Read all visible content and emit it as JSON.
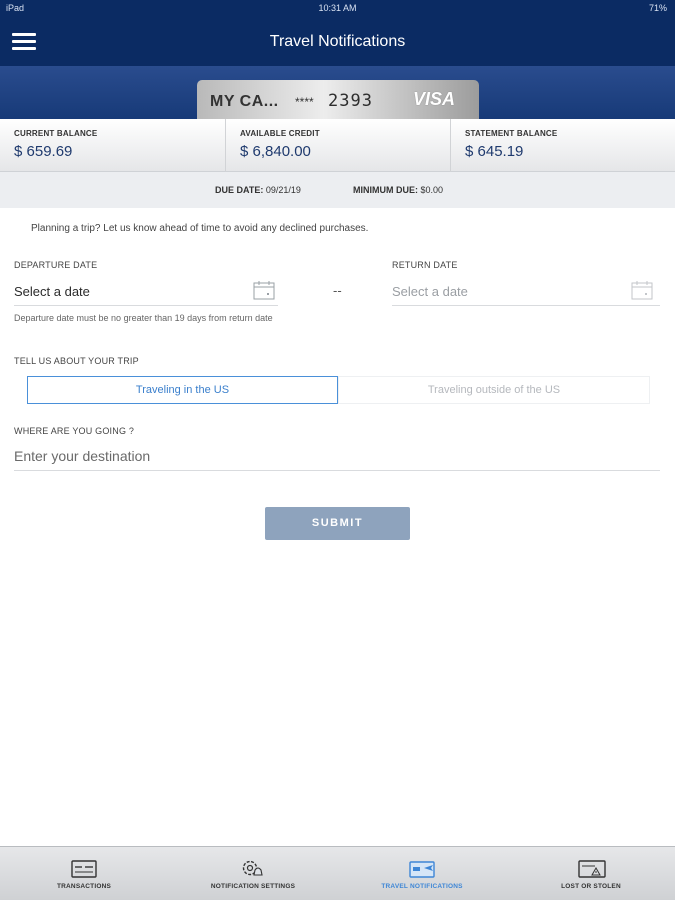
{
  "status_bar": {
    "left": "iPad",
    "time": "10:31 AM",
    "right": "71%"
  },
  "header": {
    "title": "Travel Notifications",
    "menu_icon": "hamburger-icon"
  },
  "card": {
    "name": "MY CA...",
    "mask": "****",
    "last_digits": "2393",
    "brand": "VISA"
  },
  "balances": [
    {
      "label": "CURRENT BALANCE",
      "value": "$ 659.69"
    },
    {
      "label": "AVAILABLE CREDIT",
      "value": "$ 6,840.00"
    },
    {
      "label": "STATEMENT BALANCE",
      "value": "$ 645.19"
    }
  ],
  "due": {
    "due_label": "DUE DATE:",
    "due_value": "09/21/19",
    "min_label": "MINIMUM DUE:",
    "min_value": "$0.00"
  },
  "form": {
    "intro": "Planning a trip? Let us know ahead of time to avoid any declined purchases.",
    "departure_label": "DEPARTURE DATE",
    "departure_value": "Select a date",
    "return_label": "RETURN DATE",
    "return_value": "Select a date",
    "separator": "--",
    "hint": "Departure date must be no greater than 19 days from return date",
    "trip_label": "TELL US ABOUT YOUR TRIP",
    "trip_options": [
      "Traveling in the US",
      "Traveling outside of the US"
    ],
    "trip_selected": "Traveling in the US",
    "destination_label": "WHERE ARE YOU GOING ?",
    "destination_placeholder": "Enter your destination",
    "destination_value": "",
    "submit_label": "SUBMIT"
  },
  "tabs": [
    {
      "label": "TRANSACTIONS",
      "icon": "card-list-icon",
      "active": false
    },
    {
      "label": "NOTIFICATION SETTINGS",
      "icon": "gear-bell-icon",
      "active": false
    },
    {
      "label": "TRAVEL NOTIFICATIONS",
      "icon": "card-plane-icon",
      "active": true
    },
    {
      "label": "LOST OR STOLEN",
      "icon": "card-alert-icon",
      "active": false
    }
  ],
  "colors": {
    "header": "#0b2b63",
    "accent": "#3e86d6",
    "submit_disabled": "#8ea3bd"
  }
}
